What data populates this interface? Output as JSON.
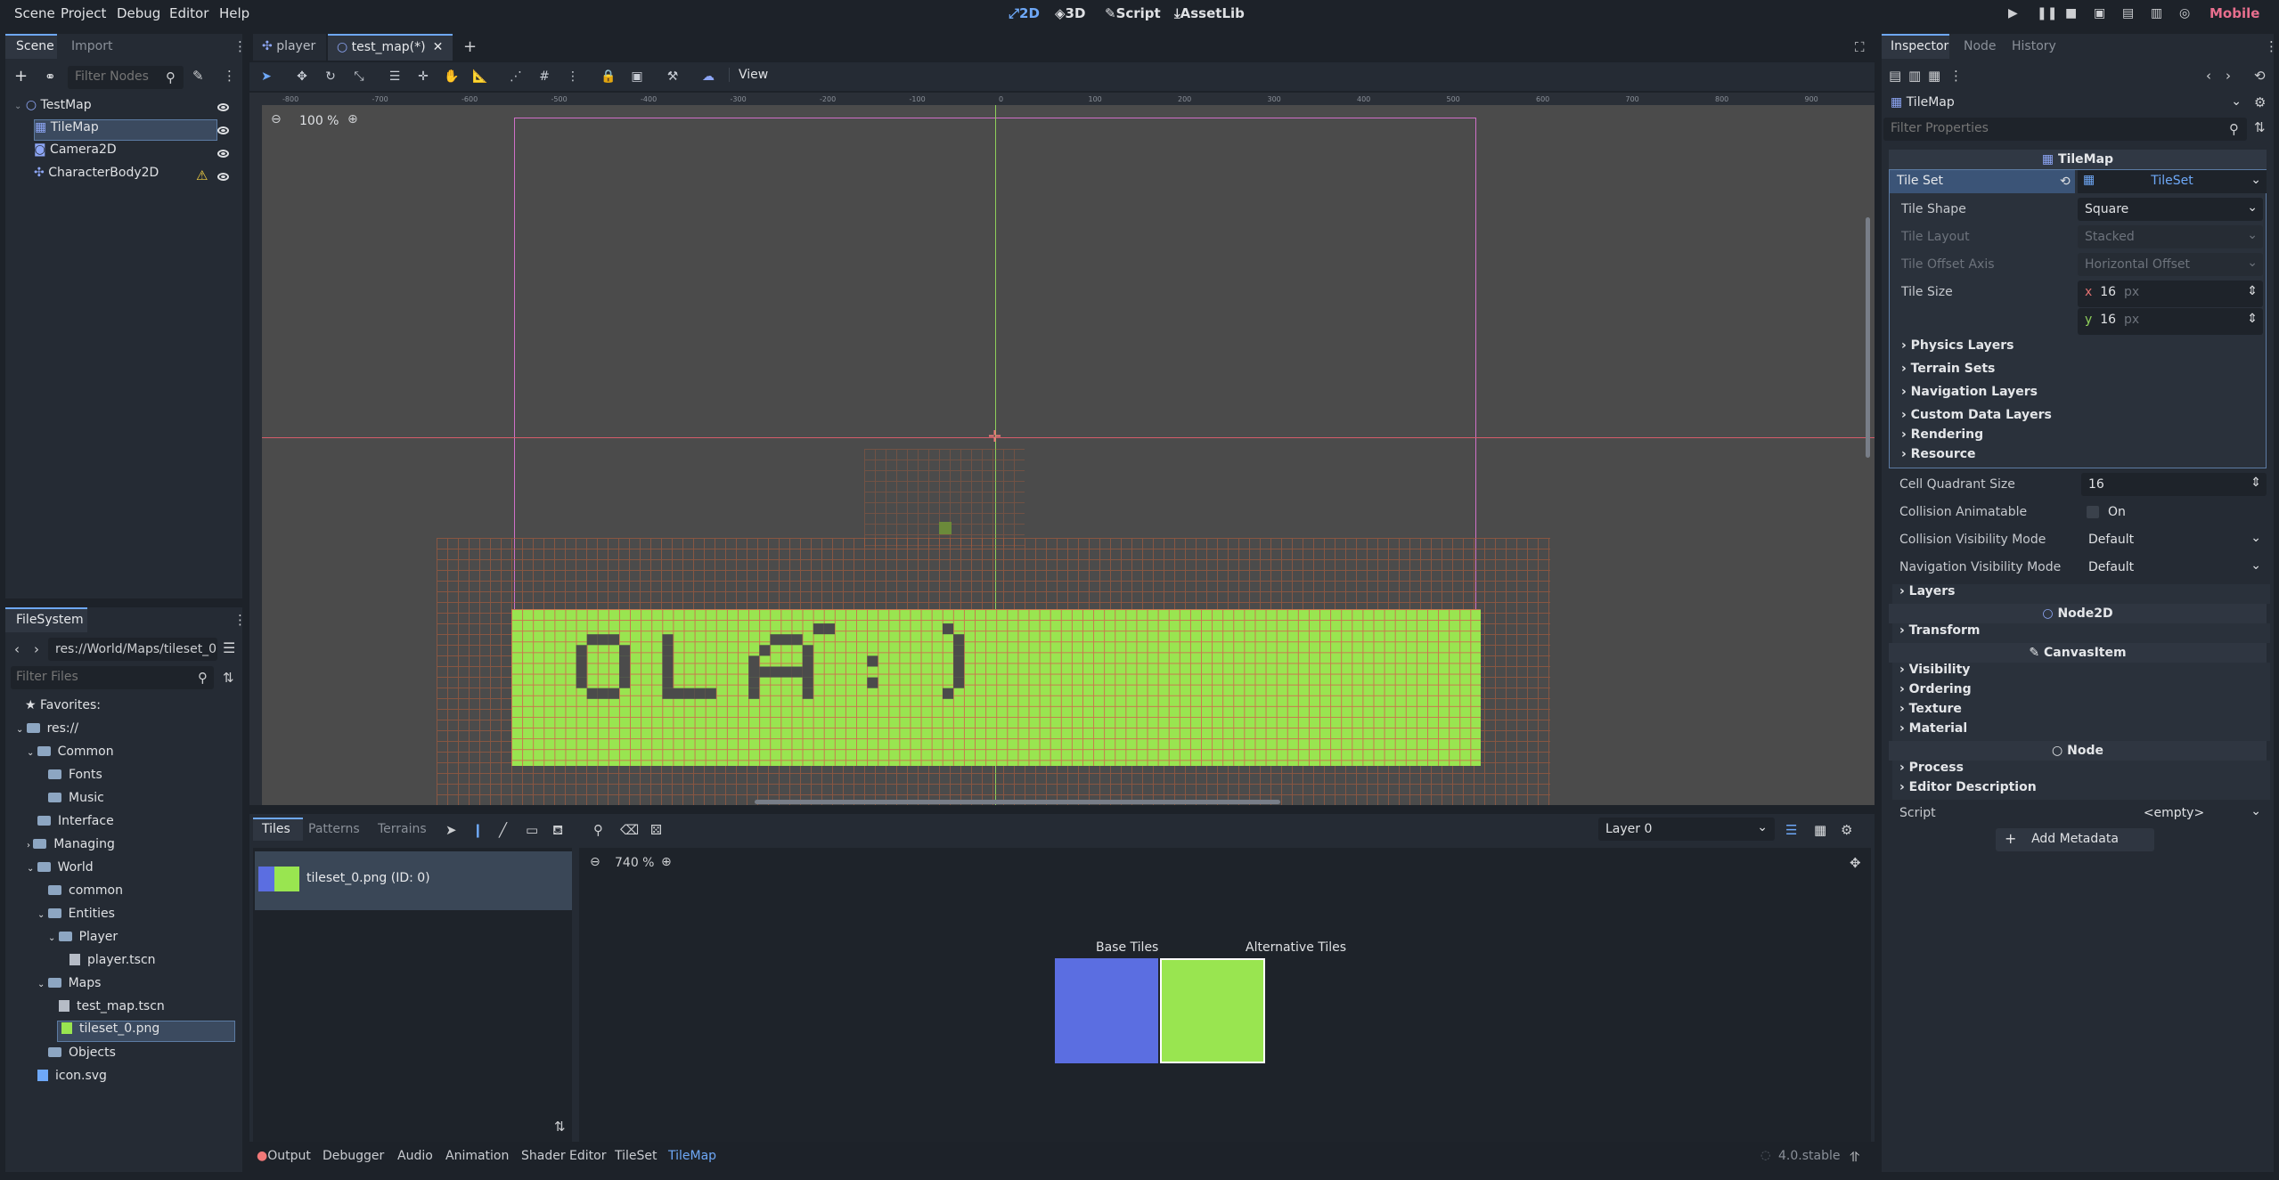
{
  "menu": {
    "scene": "Scene",
    "project": "Project",
    "debug": "Debug",
    "editor": "Editor",
    "help": "Help"
  },
  "workspaces": {
    "w2d": "2D",
    "w3d": "3D",
    "script": "Script",
    "assetlib": "AssetLib"
  },
  "renderer": "Mobile",
  "scene_dock": {
    "tab_scene": "Scene",
    "tab_import": "Import",
    "filter_placeholder": "Filter Nodes",
    "nodes": [
      {
        "label": "TestMap"
      },
      {
        "label": "TileMap"
      },
      {
        "label": "Camera2D"
      },
      {
        "label": "CharacterBody2D"
      }
    ]
  },
  "filesystem": {
    "tab": "FileSystem",
    "path": "res://World/Maps/tileset_0",
    "filter_placeholder": "Filter Files",
    "items": [
      "Favorites:",
      "res://",
      "Common",
      "Fonts",
      "Music",
      "Interface",
      "Managing",
      "World",
      "common",
      "Entities",
      "Player",
      "player.tscn",
      "Maps",
      "test_map.tscn",
      "tileset_0.png",
      "Objects",
      "icon.svg"
    ]
  },
  "editor_tabs": {
    "tab1": "player",
    "tab2": "test_map(*)"
  },
  "toolbar": {
    "view": "View"
  },
  "viewport": {
    "zoom": "100 %",
    "tile_text": "OLÁ :)"
  },
  "ruler_labels": [
    "-800",
    "-700",
    "-600",
    "-500",
    "-400",
    "-300",
    "-200",
    "-100",
    "0",
    "100",
    "200",
    "300",
    "400",
    "500",
    "600",
    "700",
    "800",
    "900"
  ],
  "tiles_panel": {
    "tab_tiles": "Tiles",
    "tab_patterns": "Patterns",
    "tab_terrains": "Terrains",
    "layer": "Layer 0",
    "source": "tileset_0.png (ID: 0)",
    "zoom": "740 %",
    "base_tiles": "Base Tiles",
    "alt_tiles": "Alternative Tiles"
  },
  "bottom_bar": {
    "output": "Output",
    "debugger": "Debugger",
    "audio": "Audio",
    "animation": "Animation",
    "shader_editor": "Shader Editor",
    "tileset": "TileSet",
    "tilemap": "TileMap",
    "version": "4.0.stable"
  },
  "inspector": {
    "tab_inspector": "Inspector",
    "tab_node": "Node",
    "tab_history": "History",
    "object": "TileMap",
    "filter_placeholder": "Filter Properties",
    "class_header": "TileMap",
    "tile_set_label": "Tile Set",
    "tile_set_value": "TileSet",
    "tile_shape_label": "Tile Shape",
    "tile_shape_value": "Square",
    "tile_layout_label": "Tile Layout",
    "tile_layout_value": "Stacked",
    "tile_offset_label": "Tile Offset Axis",
    "tile_offset_value": "Horizontal Offset",
    "tile_size_label": "Tile Size",
    "tile_size_x": "16",
    "tile_size_y": "16",
    "px": "px",
    "x": "x",
    "y": "y",
    "sub_sections": [
      "Physics Layers",
      "Terrain Sets",
      "Navigation Layers",
      "Custom Data Layers",
      "Rendering",
      "Resource"
    ],
    "cell_quadrant_label": "Cell Quadrant Size",
    "cell_quadrant_value": "16",
    "collision_anim_label": "Collision Animatable",
    "collision_anim_value": "On",
    "collision_vis_label": "Collision Visibility Mode",
    "collision_vis_value": "Default",
    "nav_vis_label": "Navigation Visibility Mode",
    "nav_vis_value": "Default",
    "layers": "Layers",
    "node2d": "Node2D",
    "transform": "Transform",
    "canvasitem": "CanvasItem",
    "visibility": "Visibility",
    "ordering": "Ordering",
    "texture": "Texture",
    "material": "Material",
    "node": "Node",
    "process": "Process",
    "editor_desc": "Editor Description",
    "script_label": "Script",
    "script_value": "<empty>",
    "add_metadata": "Add Metadata"
  },
  "colors": {
    "accent": "#6ea8f7",
    "tile_green": "#99e550",
    "tile_blue": "#5b6ee1",
    "tile_dark": "#4b4b4b"
  }
}
